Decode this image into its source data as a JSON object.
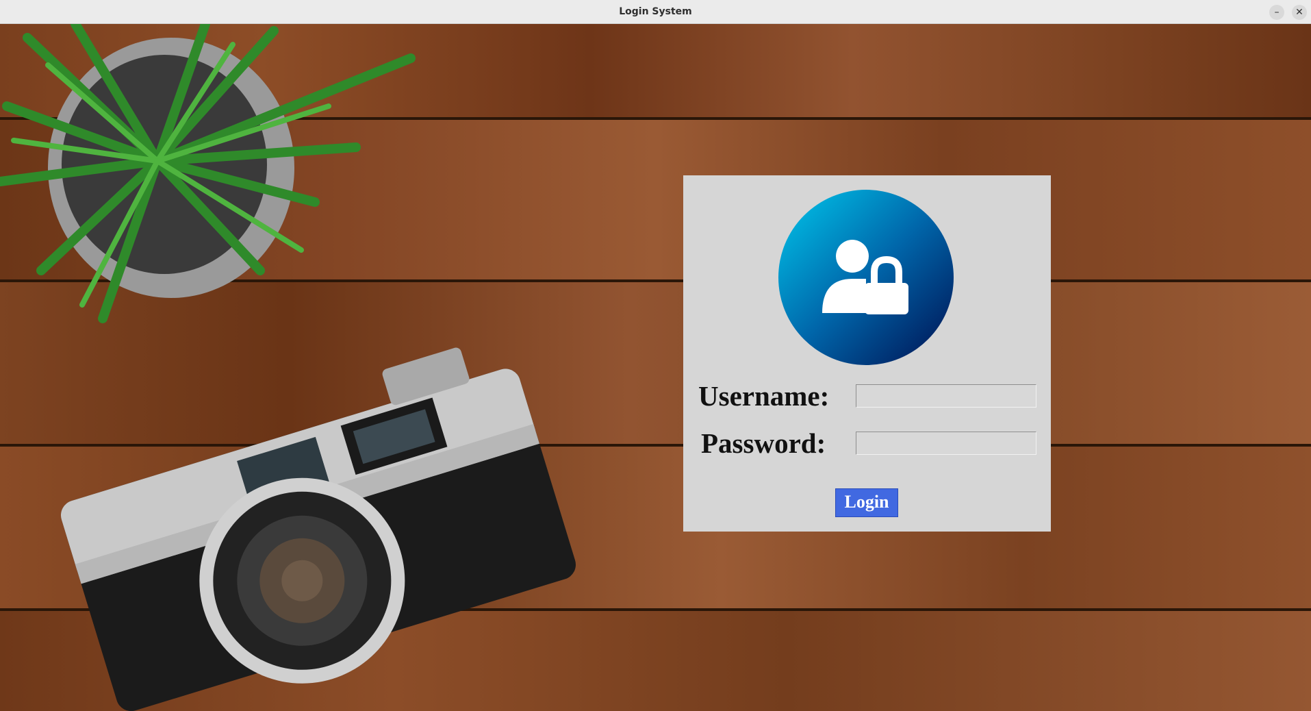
{
  "window": {
    "title": "Login System",
    "minimize_glyph": "–",
    "close_glyph": "✕"
  },
  "background": {
    "description_icons": [
      "plant-icon",
      "camera-icon"
    ]
  },
  "login": {
    "username_label": "Username:",
    "username_value": "",
    "password_label": "Password:",
    "password_value": "",
    "login_button_label": "Login",
    "avatar_icon": "user-lock-icon"
  },
  "colors": {
    "button": "#4169e1",
    "card": "#d6d6d6",
    "avatar_gradient_start": "#00b4e0",
    "avatar_gradient_end": "#001a5c"
  }
}
